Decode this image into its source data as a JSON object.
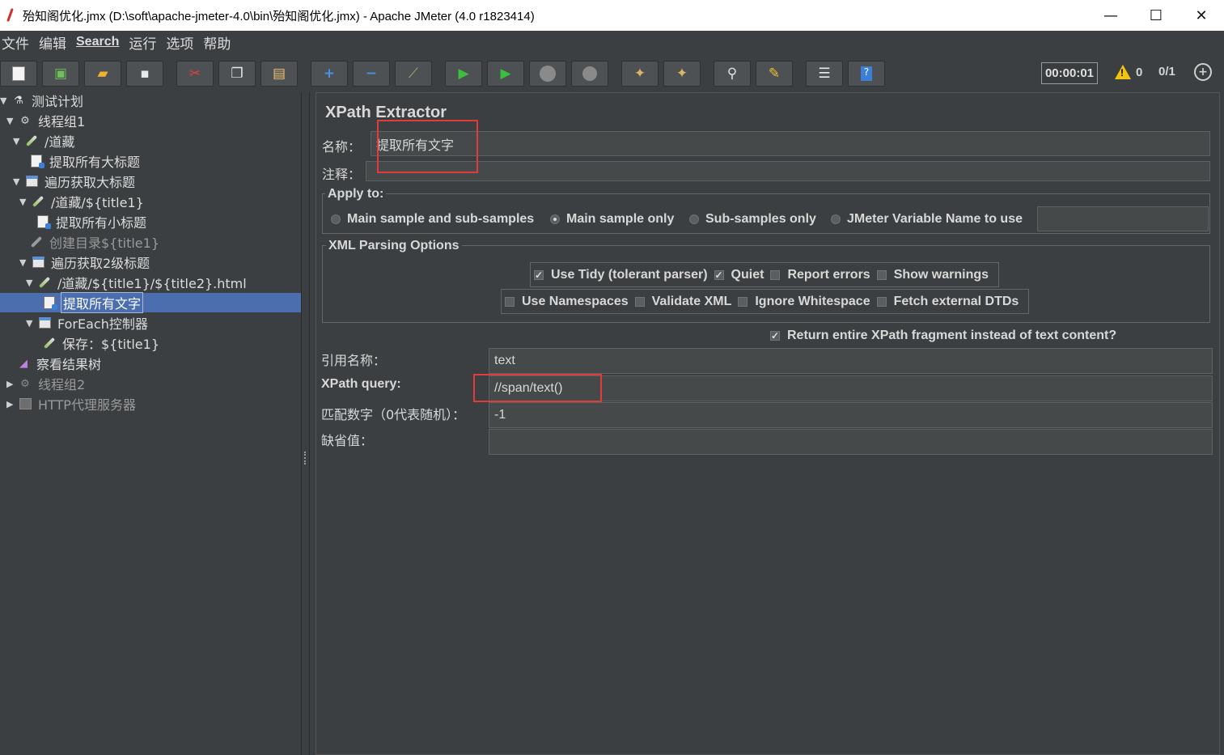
{
  "window": {
    "title": "殆知阁优化.jmx (D:\\soft\\apache-jmeter-4.0\\bin\\殆知阁优化.jmx) - Apache JMeter (4.0 r1823414)",
    "minimize": "—",
    "maximize": "☐",
    "close": "✕"
  },
  "menu": [
    "文件",
    "编辑",
    "Search",
    "运行",
    "选项",
    "帮助"
  ],
  "toolbar": {
    "timer": "00:00:01",
    "warnings": "0",
    "threads": "0/1",
    "icons": [
      "new-icon",
      "templates-icon",
      "open-icon",
      "save-icon",
      "cut-icon",
      "copy-icon",
      "paste-icon",
      "expand-icon",
      "collapse-icon",
      "toggle-icon",
      "start-icon",
      "start-no-pause-icon",
      "stop-icon",
      "shutdown-icon",
      "clear-icon",
      "clear-all-icon",
      "search-icon",
      "reset-search-icon",
      "function-helper-icon",
      "help-icon"
    ]
  },
  "tree": [
    {
      "label": "测试计划",
      "icon": "test-plan-icon"
    },
    {
      "label": "线程组1",
      "icon": "gear-icon"
    },
    {
      "label": "/道藏",
      "icon": "sampler-pen-icon"
    },
    {
      "label": "提取所有大标题",
      "icon": "extractor-doc-icon"
    },
    {
      "label": "遍历获取大标题",
      "icon": "loop-controller-icon"
    },
    {
      "label": "/道藏/${title1}",
      "icon": "sampler-pen-icon"
    },
    {
      "label": "提取所有小标题",
      "icon": "extractor-doc-icon"
    },
    {
      "label": "创建目录${title1}",
      "icon": "sampler-pen-icon"
    },
    {
      "label": "遍历获取2级标题",
      "icon": "loop-controller-icon"
    },
    {
      "label": "/道藏/${title1}/${title2}.html",
      "icon": "sampler-pen-icon"
    },
    {
      "label": "提取所有文字",
      "icon": "extractor-doc-icon"
    },
    {
      "label": "ForEach控制器",
      "icon": "loop-controller-icon"
    },
    {
      "label": "保存：${title1}",
      "icon": "sampler-pen-icon"
    },
    {
      "label": "察看结果树",
      "icon": "listener-icon"
    },
    {
      "label": "线程组2",
      "icon": "gear-icon"
    },
    {
      "label": "HTTP代理服务器",
      "icon": "proxy-icon"
    }
  ],
  "panel": {
    "title": "XPath Extractor",
    "name_label": "名称：",
    "name_value": "提取所有文字",
    "comment_label": "注释：",
    "comment_value": "",
    "apply_to": {
      "title": "Apply to:",
      "options": [
        "Main sample and sub-samples",
        "Main sample only",
        "Sub-samples only",
        "JMeter Variable Name to use"
      ],
      "selected": "Main sample only",
      "variable_value": ""
    },
    "xml_parsing": {
      "title": "XML Parsing Options",
      "use_tidy": "Use Tidy (tolerant parser)",
      "quiet": "Quiet",
      "report_errors": "Report errors",
      "show_warnings": "Show warnings",
      "use_namespaces": "Use Namespaces",
      "validate_xml": "Validate XML",
      "ignore_whitespace": "Ignore Whitespace",
      "fetch_dtds": "Fetch external DTDs",
      "checked": [
        "Use Tidy (tolerant parser)",
        "Quiet"
      ]
    },
    "return_fragment": "Return entire XPath fragment instead of text content?",
    "return_fragment_checked": true,
    "ref_name_label": "引用名称：",
    "ref_name_value": "text",
    "xpath_label": "XPath query:",
    "xpath_value": "//span/text()",
    "match_no_label": "匹配数字（0代表随机）：",
    "match_no_value": "-1",
    "default_label": "缺省值：",
    "default_value": ""
  },
  "colors": {
    "background": "#3c3f41",
    "selection": "#4b6eaf",
    "highlight_box": "#e23b3b"
  }
}
